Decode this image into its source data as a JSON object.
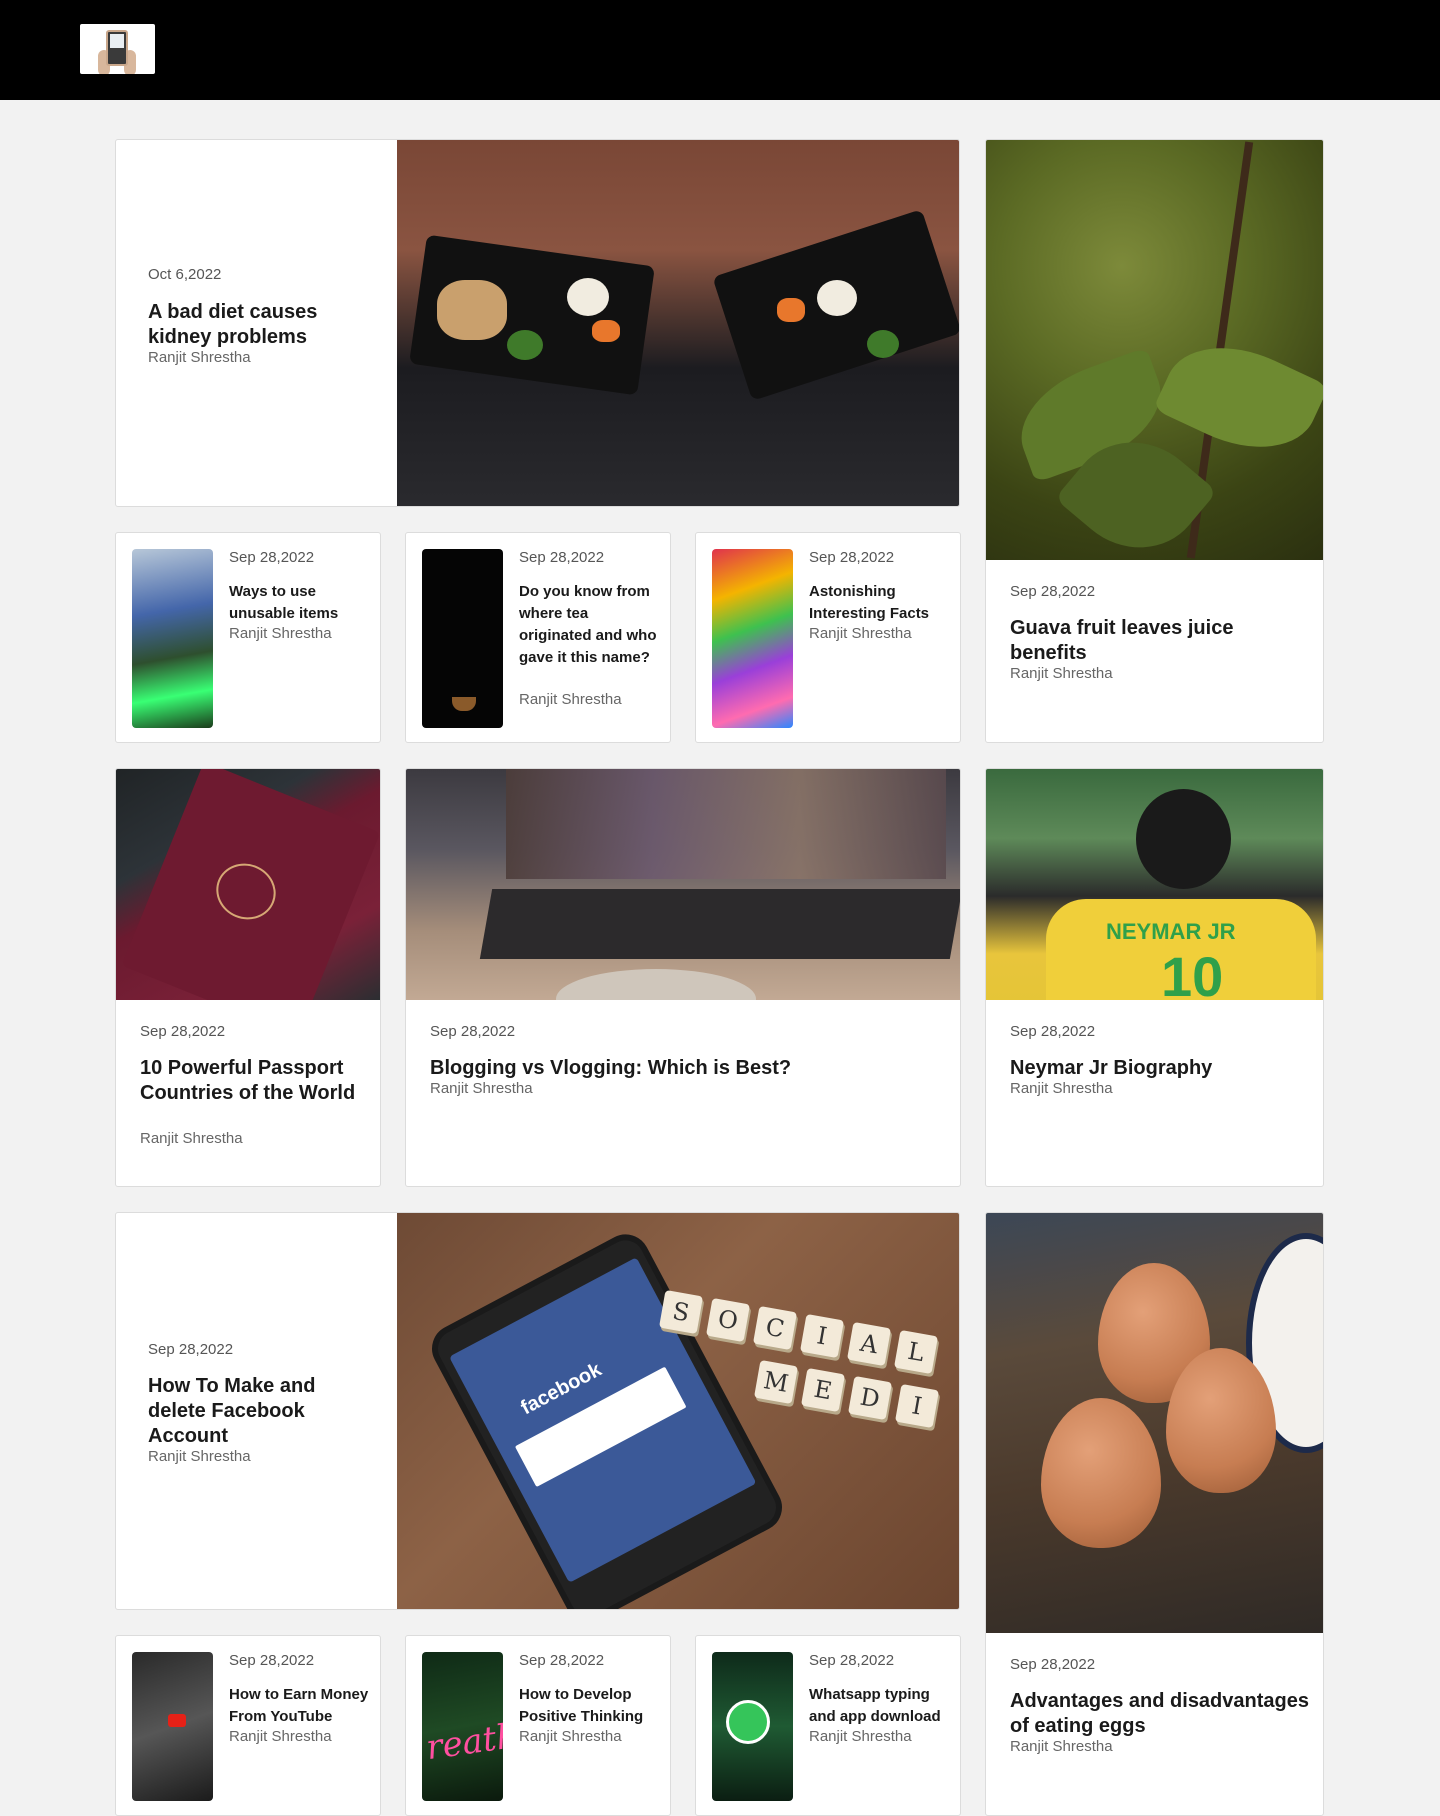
{
  "header": {
    "logo_icon": "phone-in-hand-logo",
    "background": "#000000"
  },
  "featured": [
    {
      "date": "Oct 6,2022",
      "title": "A bad diet causes kidney problems",
      "author": "Ranjit Shrestha",
      "image": "meal-prep-containers"
    },
    {
      "date": "Sep 28,2022",
      "title": "How To Make and delete Facebook Account",
      "author": "Ranjit Shrestha",
      "image": "facebook-phone-social-media-tiles"
    }
  ],
  "side_cards": [
    {
      "date": "Sep 28,2022",
      "title": "Guava fruit leaves juice benefits",
      "author": "Ranjit Shrestha",
      "image": "guava-leaves"
    },
    {
      "date": "Sep 28,2022",
      "title": "Advantages and disadvantages of eating eggs",
      "author": "Ranjit Shrestha",
      "image": "brown-eggs"
    }
  ],
  "small_row_1": [
    {
      "date": "Sep 28,2022",
      "title": "Ways to use unusable items",
      "author": "Ranjit Shrestha",
      "image": "plastic-bottles"
    },
    {
      "date": "Sep 28,2022",
      "title": "Do you know from where tea originated and who gave it this name?",
      "author": "Ranjit Shrestha",
      "image": "tea-cup-dark"
    },
    {
      "date": "Sep 28,2022",
      "title": "Astonishing Interesting Facts",
      "author": "Ranjit Shrestha",
      "image": "gumballs"
    }
  ],
  "medium_row": [
    {
      "date": "Sep 28,2022",
      "title": "10 Powerful Passport Countries of the World",
      "author": "Ranjit Shrestha",
      "image": "passport"
    },
    {
      "date": "Sep 28,2022",
      "title": "Blogging vs Vlogging: Which is Best?",
      "author": "Ranjit Shrestha",
      "image": "laptop-video-call"
    },
    {
      "date": "Sep 28,2022",
      "title": "Neymar Jr Biography",
      "author": "Ranjit Shrestha",
      "image": "neymar-jersey",
      "jersey_text": "NEYMAR JR",
      "jersey_number": "10"
    }
  ],
  "small_row_2": [
    {
      "date": "Sep 28,2022",
      "title": "How to Earn Money From YouTube",
      "author": "Ranjit Shrestha",
      "image": "youtube-phone"
    },
    {
      "date": "Sep 28,2022",
      "title": "How to Develop Positive Thinking",
      "author": "Ranjit Shrestha",
      "image": "neon-breathe-sign",
      "neon_text": "reath"
    },
    {
      "date": "Sep 28,2022",
      "title": "Whatsapp typing and app download",
      "author": "Ranjit Shrestha",
      "image": "whatsapp-logo"
    }
  ],
  "fb_image_text": {
    "brand": "facebook",
    "tiles_row1": [
      "S",
      "O",
      "C",
      "I",
      "A",
      "L"
    ],
    "tiles_row2": [
      "M",
      "E",
      "D",
      "I"
    ]
  }
}
